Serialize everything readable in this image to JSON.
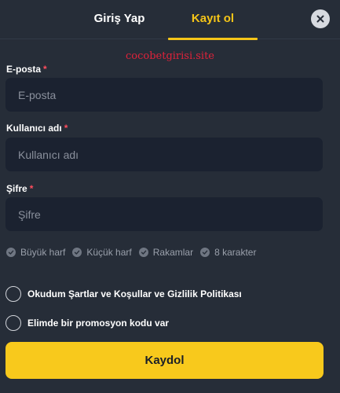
{
  "tabs": {
    "login": "Giriş Yap",
    "register": "Kayıt ol"
  },
  "watermark": "cocobetgirisi.site",
  "fields": {
    "email": {
      "label": "E-posta",
      "required": "*",
      "placeholder": "E-posta",
      "value": ""
    },
    "username": {
      "label": "Kullanıcı adı",
      "required": "*",
      "placeholder": "Kullanıcı adı",
      "value": ""
    },
    "password": {
      "label": "Şifre",
      "required": "*",
      "placeholder": "Şifre",
      "value": ""
    }
  },
  "password_rules": [
    {
      "label": "Büyük harf",
      "met": false
    },
    {
      "label": "Küçük harf",
      "met": false
    },
    {
      "label": "Rakamlar",
      "met": false
    },
    {
      "label": "8 karakter",
      "met": false
    }
  ],
  "checkboxes": {
    "terms": {
      "label": "Okudum Şartlar ve Koşullar ve Gizlilik Politikası",
      "checked": false
    },
    "promo": {
      "label": "Elimde bir promosyon kodu var",
      "checked": false
    }
  },
  "submit_label": "Kaydol",
  "colors": {
    "background": "#262d38",
    "input_background": "#1b2230",
    "accent": "#f5c518",
    "required": "#ff4d5e",
    "watermark": "#e0223a"
  },
  "icons": {
    "close": "close-icon",
    "rule": "check-circle-icon"
  }
}
